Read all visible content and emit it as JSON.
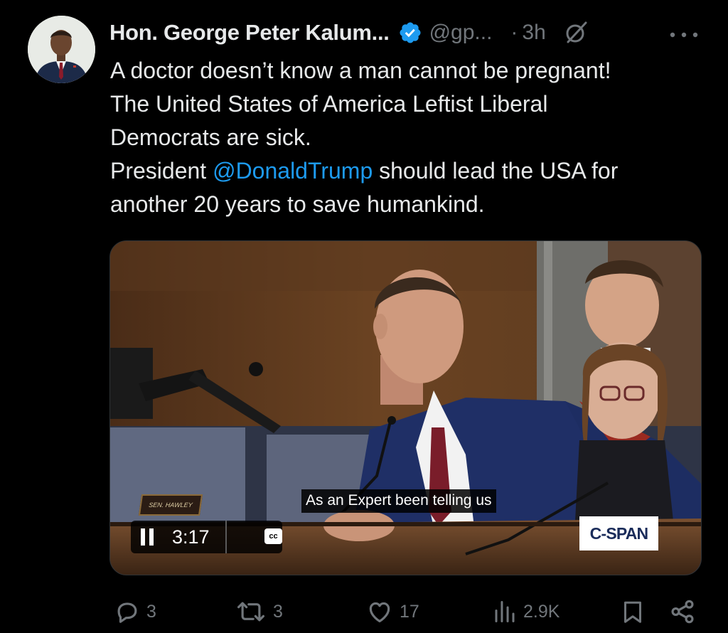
{
  "tweet": {
    "author_name": "Hon. George Peter Kalum...",
    "handle": "@gp...",
    "separator": "·",
    "time": "3h",
    "text_lines": [
      "A doctor doesn’t know a man cannot be pregnant!",
      "The United States of America Leftist Liberal",
      "Democrats are sick."
    ],
    "line4_prefix": "President ",
    "mention": "@DonaldTrump",
    "line4_suffix": " should lead the USA for",
    "line5": "another 20 years to save humankind."
  },
  "video": {
    "caption": "As an Expert been telling us",
    "elapsed": "3:17",
    "cc_label": "cc",
    "channel_logo": "C-SPAN",
    "nameplate": "SEN. HAWLEY"
  },
  "actions": {
    "replies": "3",
    "reposts": "3",
    "likes": "17",
    "views": "2.9K"
  },
  "colors": {
    "background": "#000000",
    "text": "#e7e9ea",
    "muted": "#71767b",
    "accent": "#1d9bf0"
  },
  "icons": [
    "verified-badge-icon",
    "grok-icon",
    "more-icon",
    "reply-icon",
    "repost-icon",
    "like-icon",
    "views-icon",
    "bookmark-icon",
    "share-icon",
    "pause-icon",
    "cc-icon"
  ]
}
